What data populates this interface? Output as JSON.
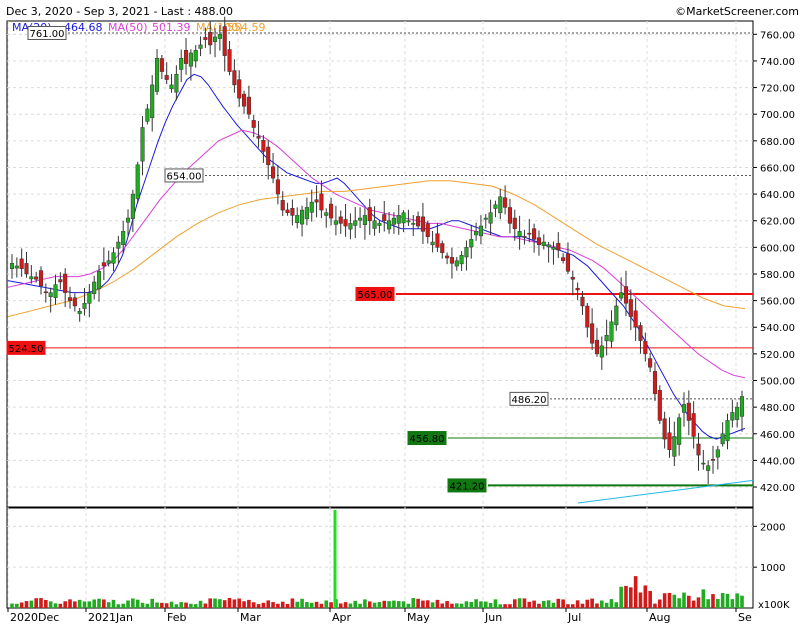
{
  "header": {
    "range_text": "Dec 3, 2020 - Sep 3, 2021 - Last : 488.00",
    "source_text": "©MarketScreener.com"
  },
  "legend": [
    {
      "label": "MA(20)",
      "value": "464.68",
      "color": "#1a1adb"
    },
    {
      "label": "MA(50)",
      "value": "501.39",
      "color": "#d93fd9"
    },
    {
      "label": "MA(100)",
      "value": "554.59",
      "color": "#f0a030"
    }
  ],
  "volume_unit": "x100K",
  "chart_data": {
    "type": "candlestick",
    "price_axis": {
      "min": 405,
      "max": 770,
      "ticks": [
        420,
        440,
        460,
        480,
        500,
        520,
        540,
        560,
        580,
        600,
        620,
        640,
        660,
        680,
        700,
        720,
        740,
        760
      ]
    },
    "volume_axis": {
      "min": 0,
      "max": 2400,
      "ticks": [
        1000,
        2000
      ],
      "tick_labels": [
        "1000",
        "2000"
      ]
    },
    "x_labels": [
      "2020Dec",
      "2021Jan",
      "Feb",
      "Mar",
      "Apr",
      "May",
      "Jun",
      "Jul",
      "Aug",
      "Se"
    ],
    "last": 488.0,
    "levels": [
      {
        "value": 761.0,
        "label": "761.00",
        "kind": "dotted"
      },
      {
        "value": 654.0,
        "label": "654.00",
        "kind": "dotted"
      },
      {
        "value": 565.0,
        "label": "565.00",
        "kind": "resistance"
      },
      {
        "value": 524.5,
        "label": "524.50",
        "kind": "resistance-thin"
      },
      {
        "value": 486.2,
        "label": "486.20",
        "kind": "dotted"
      },
      {
        "value": 456.8,
        "label": "456.80",
        "kind": "support-thin"
      },
      {
        "value": 421.2,
        "label": "421.20",
        "kind": "support"
      }
    ],
    "close_series": [
      588,
      586,
      584,
      580,
      578,
      576,
      571,
      566,
      566,
      572,
      574,
      566,
      560,
      556,
      552,
      558,
      566,
      574,
      582,
      586,
      590,
      596,
      604,
      612,
      622,
      640,
      662,
      690,
      704,
      722,
      742,
      732,
      726,
      722,
      730,
      742,
      738,
      746,
      748,
      752,
      756,
      752,
      758,
      760,
      744,
      732,
      722,
      712,
      706,
      700,
      690,
      682,
      672,
      662,
      652,
      640,
      628,
      626,
      624,
      624,
      628,
      630,
      634,
      634,
      628,
      626,
      622,
      620,
      618,
      616,
      618,
      620,
      622,
      624,
      620,
      620,
      618,
      620,
      620,
      622,
      624,
      626,
      620,
      618,
      616,
      612,
      608,
      604,
      600,
      596,
      592,
      588,
      590,
      594,
      600,
      606,
      612,
      616,
      622,
      626,
      632,
      638,
      630,
      618,
      614,
      612,
      608,
      610,
      606,
      602,
      604,
      602,
      600,
      598,
      590,
      582,
      576,
      568,
      556,
      540,
      528,
      520,
      526,
      534,
      544,
      556,
      566,
      558,
      548,
      540,
      530,
      520,
      510,
      490,
      470,
      456,
      448,
      458,
      472,
      482,
      470,
      458,
      444,
      438,
      436,
      440,
      448,
      460,
      470,
      476,
      480,
      488
    ],
    "ma20_series": [
      575,
      574,
      573,
      572,
      571,
      570,
      569,
      568,
      567,
      566,
      566,
      566,
      567,
      570,
      575,
      583,
      594,
      612,
      632,
      648,
      664,
      680,
      694,
      706,
      716,
      726,
      730,
      728,
      722,
      714,
      706,
      699,
      692,
      686,
      680,
      674,
      668,
      664,
      660,
      656,
      654,
      652,
      650,
      648,
      648,
      650,
      652,
      648,
      642,
      636,
      630,
      624,
      620,
      618,
      616,
      614,
      614,
      614,
      614,
      614,
      616,
      618,
      620,
      620,
      618,
      616,
      614,
      612,
      610,
      608,
      608,
      608,
      608,
      606,
      604,
      602,
      600,
      598,
      596,
      594,
      590,
      586,
      580,
      574,
      568,
      562,
      556,
      548,
      540,
      530,
      520,
      510,
      500,
      490,
      482,
      474,
      468,
      462,
      458,
      456,
      458,
      460,
      462,
      464
    ],
    "ma50_series": [
      570,
      572,
      574,
      576,
      578,
      578,
      578,
      580,
      584,
      590,
      600,
      612,
      624,
      636,
      646,
      656,
      664,
      672,
      680,
      684,
      688,
      686,
      682,
      676,
      668,
      660,
      652,
      646,
      640,
      636,
      632,
      628,
      626,
      624,
      622,
      620,
      618,
      618,
      616,
      614,
      612,
      610,
      608,
      608,
      606,
      604,
      602,
      600,
      598,
      594,
      590,
      584,
      576,
      568,
      560,
      552,
      544,
      536,
      528,
      520,
      514,
      508,
      504,
      502
    ],
    "ma100_series": [
      548,
      552,
      556,
      560,
      566,
      574,
      584,
      596,
      608,
      618,
      626,
      632,
      636,
      638,
      640,
      642,
      642,
      644,
      646,
      648,
      650,
      650,
      648,
      646,
      640,
      632,
      622,
      612,
      602,
      594,
      586,
      578,
      570,
      562,
      556,
      554
    ],
    "trendline": {
      "from": 408,
      "to": 425
    }
  }
}
